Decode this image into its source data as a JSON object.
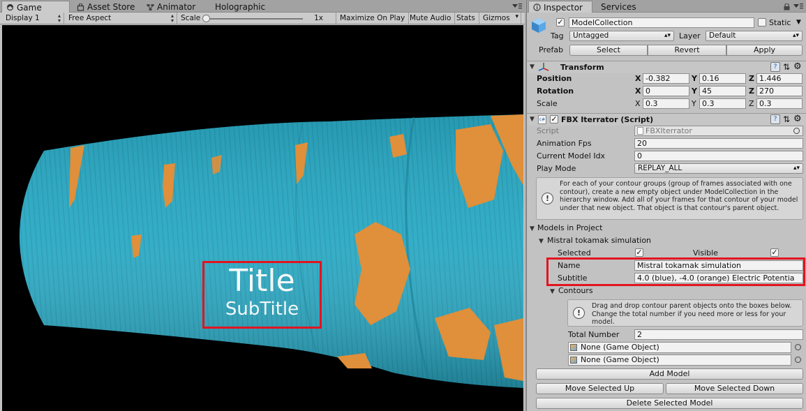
{
  "game_panel": {
    "tabs": [
      {
        "label": "Game",
        "icon": "game-icon",
        "active": true
      },
      {
        "label": "Asset Store",
        "icon": "asset-store-icon"
      },
      {
        "label": "Animator",
        "icon": "animator-icon"
      },
      {
        "label": "Holographic"
      }
    ],
    "toolbar": {
      "display": "Display 1",
      "aspect": "Free Aspect",
      "scale_label": "Scale",
      "scale_value": "1x",
      "maximize": "Maximize On Play",
      "mute": "Mute Audio",
      "stats": "Stats",
      "gizmos": "Gizmos"
    },
    "overlay": {
      "title": "Title",
      "subtitle": "SubTitle"
    },
    "colors": {
      "tube": "#2aa9c4",
      "patches": "#e08f3a",
      "highlight": "#e3141f"
    }
  },
  "inspector": {
    "tabs": [
      {
        "label": "Inspector",
        "icon": "info-icon",
        "active": true
      },
      {
        "label": "Services"
      }
    ],
    "object": {
      "name": "ModelCollection",
      "static_label": "Static",
      "tag_label": "Tag",
      "tag_value": "Untagged",
      "layer_label": "Layer",
      "layer_value": "Default",
      "prefab_label": "Prefab",
      "prefab_buttons": [
        "Select",
        "Revert",
        "Apply"
      ]
    },
    "transform": {
      "title": "Transform",
      "rows": [
        {
          "label": "Position",
          "x": "-0.382",
          "y": "0.16",
          "z": "1.446"
        },
        {
          "label": "Rotation",
          "x": "0",
          "y": "45",
          "z": "270"
        },
        {
          "label": "Scale",
          "x": "0.3",
          "y": "0.3",
          "z": "0.3"
        }
      ]
    },
    "script": {
      "title": "FBX Iterrator (Script)",
      "script_label": "Script",
      "script_value": "FBXIterrator",
      "fps_label": "Animation Fps",
      "fps_value": "20",
      "idx_label": "Current Model Idx",
      "idx_value": "0",
      "play_label": "Play Mode",
      "play_value": "REPLAY_ALL",
      "help": "For each of your contour groups (group of frames associated with one contour), create a new empty object under ModelCollection in the hierarchy window. Add all of your frames for that contour of your model under that new object. That object is that contour's parent object."
    },
    "models": {
      "header": "Models in Project",
      "model_name": "Mistral tokamak simulation",
      "selected_label": "Selected",
      "visible_label": "Visible",
      "name_label": "Name",
      "name_value": "Mistral tokamak simulation",
      "subtitle_label": "Subtitle",
      "subtitle_value": "4.0 (blue), -4.0 (orange) Electric Potentia",
      "contours_label": "Contours",
      "contours_help": "Drag and drop contour parent objects onto the boxes below. Change the total number if you need more or less for your model.",
      "total_label": "Total Number",
      "total_value": "2",
      "slots": [
        "None (Game Object)",
        "None (Game Object)"
      ],
      "add_button": "Add Model",
      "move_up_button": "Move Selected Up",
      "move_down_button": "Move Selected Down",
      "delete_button": "Delete Selected Model"
    }
  }
}
